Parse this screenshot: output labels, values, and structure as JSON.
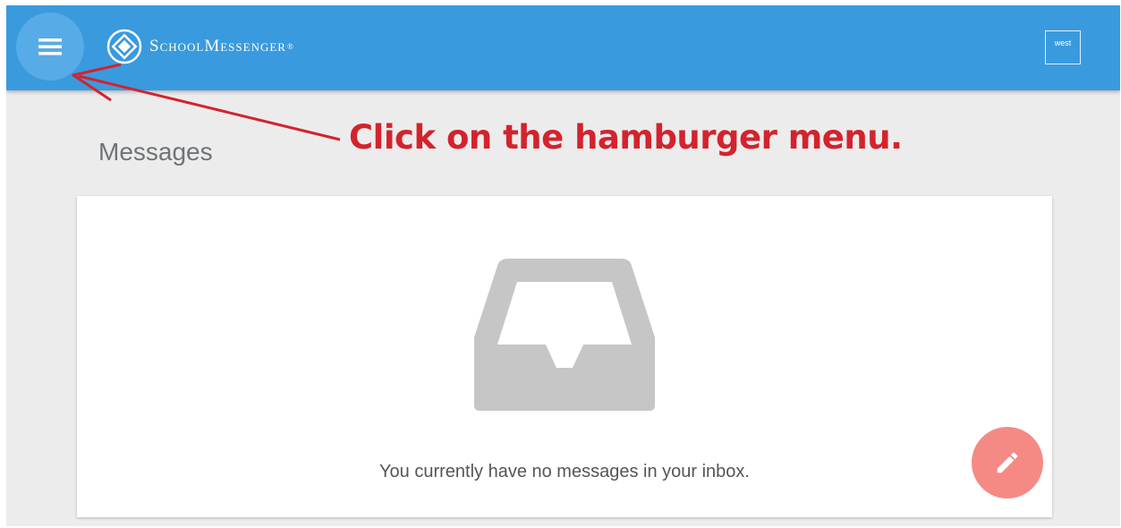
{
  "header": {
    "brand": "SchoolMessenger",
    "brand_mark": "®",
    "user_label": "west",
    "menu_icon": "hamburger-menu-icon",
    "bar_color": "#3a9ade"
  },
  "main": {
    "title": "Messages",
    "empty_state": {
      "icon": "inbox-tray-icon",
      "message": "You currently have no messages in your inbox."
    },
    "compose_icon": "pencil-icon",
    "compose_color": "#f58a85"
  },
  "annotation": {
    "text": "Click on the hamburger menu.",
    "color": "#d3232d"
  }
}
